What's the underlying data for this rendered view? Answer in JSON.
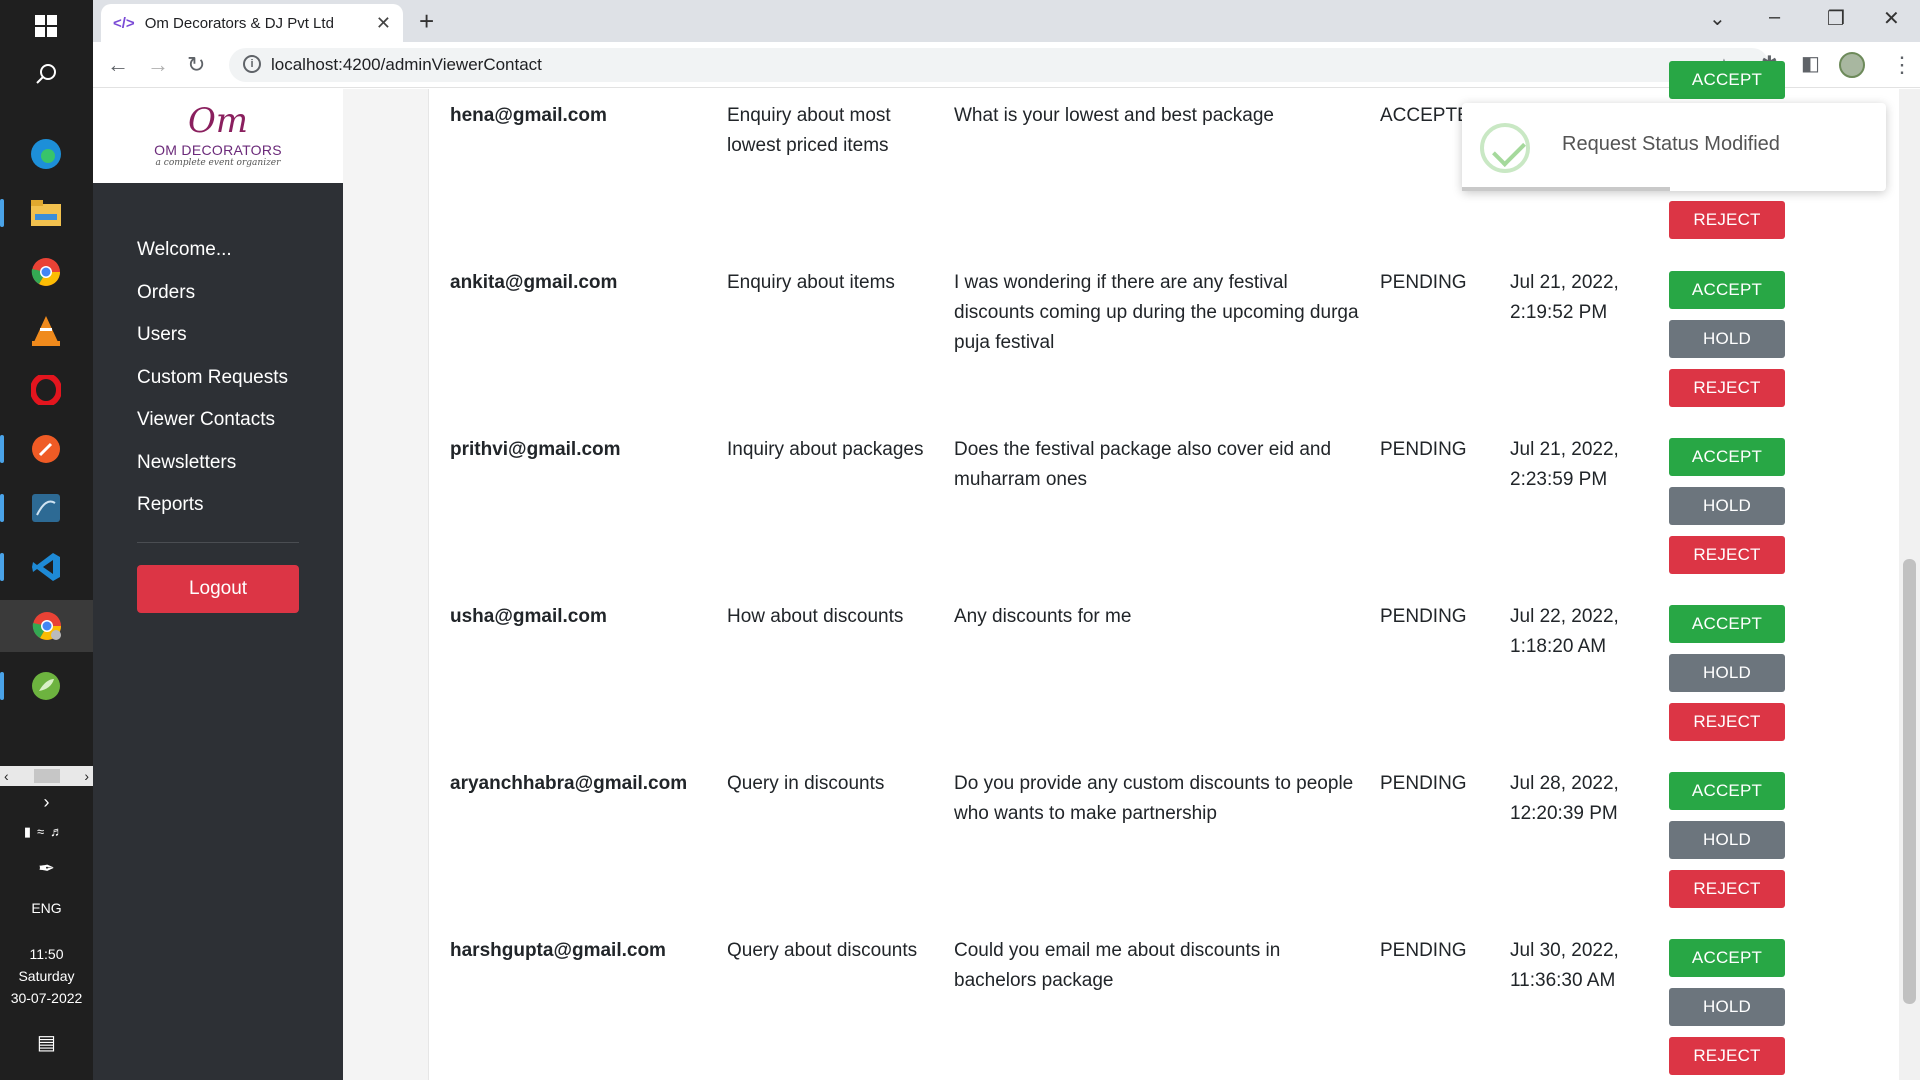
{
  "taskbar": {
    "icons": [
      "windows-start-icon",
      "search-icon",
      "edge-icon",
      "file-explorer-icon",
      "chrome-icon",
      "vlc-icon",
      "opera-icon",
      "postman-icon",
      "mysql-workbench-icon",
      "vscode-icon",
      "chrome-canary-icon",
      "spring-tools-icon"
    ],
    "language": "ENG",
    "time": "11:50",
    "day": "Saturday",
    "date": "30-07-2022"
  },
  "browser": {
    "tab_title": "Om Decorators & DJ Pvt Ltd",
    "url": "localhost:4200/adminViewerContact"
  },
  "logo": {
    "mark": "Om",
    "name": "OM DECORATORS",
    "tagline": "a complete event organizer"
  },
  "sidebar": {
    "items": [
      {
        "label": "Welcome..."
      },
      {
        "label": "Orders"
      },
      {
        "label": "Users"
      },
      {
        "label": "Custom Requests"
      },
      {
        "label": "Viewer Contacts"
      },
      {
        "label": "Newsletters"
      },
      {
        "label": "Reports"
      }
    ],
    "logout_label": "Logout"
  },
  "buttons": {
    "accept": "ACCEPT",
    "hold": "HOLD",
    "reject": "REJECT"
  },
  "rows": [
    {
      "email": "hena@gmail.com",
      "subject": "Enquiry about most lowest priced items",
      "message": "What is your lowest and best package",
      "status": "ACCEPTED",
      "date": ""
    },
    {
      "email": "ankita@gmail.com",
      "subject": "Enquiry about items",
      "message": "I was wondering if there are any festival discounts coming up during the upcoming durga puja festival",
      "status": "PENDING",
      "date": "Jul 21, 2022, 2:19:52 PM"
    },
    {
      "email": "prithvi@gmail.com",
      "subject": "Inquiry about packages",
      "message": "Does the festival package also cover eid and muharram ones",
      "status": "PENDING",
      "date": "Jul 21, 2022, 2:23:59 PM"
    },
    {
      "email": "usha@gmail.com",
      "subject": "How about discounts",
      "message": "Any discounts for me",
      "status": "PENDING",
      "date": "Jul 22, 2022, 1:18:20 AM"
    },
    {
      "email": "aryanchhabra@gmail.com",
      "subject": "Query in discounts",
      "message": "Do you provide any custom discounts to people who wants to make partnership",
      "status": "PENDING",
      "date": "Jul 28, 2022, 12:20:39 PM"
    },
    {
      "email": "harshgupta@gmail.com",
      "subject": "Query about discounts",
      "message": "Could you email me about discounts in bachelors package",
      "status": "PENDING",
      "date": "Jul 30, 2022, 11:36:30 AM"
    }
  ],
  "toast": {
    "message": "Request Status Modified"
  },
  "colors": {
    "accept": "#28a745",
    "hold": "#6c757d",
    "reject": "#dc3545",
    "sidebar": "#2d3035"
  }
}
